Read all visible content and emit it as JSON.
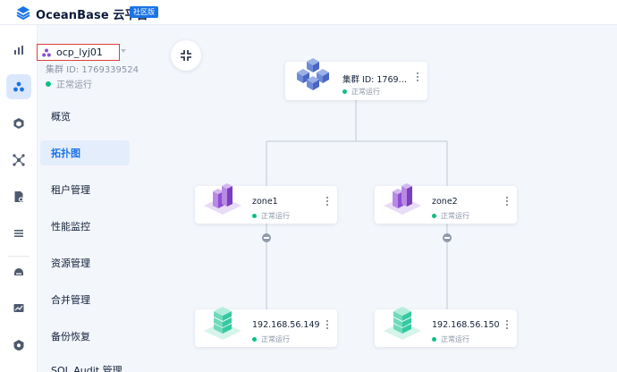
{
  "header": {
    "brand": "OceanBase 云平台",
    "edition": "社区版"
  },
  "sidebar_icons": [
    "chart-bar-icon",
    "cluster-icon",
    "cube-icon",
    "network-icon",
    "document-icon",
    "list-icon",
    "database-icon",
    "monitor-icon",
    "shield-icon"
  ],
  "cluster": {
    "name": "ocp_lyj01",
    "id_text": "集群 ID: 1769339524",
    "status": "正常运行"
  },
  "menu": {
    "items": [
      {
        "label": "概览"
      },
      {
        "label": "拓扑图"
      },
      {
        "label": "租户管理"
      },
      {
        "label": "性能监控"
      },
      {
        "label": "资源管理"
      },
      {
        "label": "合并管理"
      },
      {
        "label": "备份恢复"
      },
      {
        "label": "SQL Audit 管理"
      }
    ],
    "active": "拓扑图"
  },
  "topology": {
    "root": {
      "title": "集群 ID: 1769…",
      "status": "正常运行"
    },
    "zones": [
      {
        "title": "zone1",
        "status": "正常运行"
      },
      {
        "title": "zone2",
        "status": "正常运行"
      }
    ],
    "servers": [
      {
        "title": "192.168.56.149",
        "status": "正常运行"
      },
      {
        "title": "192.168.56.150",
        "status": "正常运行"
      }
    ]
  },
  "colors": {
    "accent": "#1a73e8",
    "status_ok": "#0ac185",
    "zone": "#8e4fd1",
    "server": "#35c9a2",
    "highlight_border": "#e23c3c"
  }
}
